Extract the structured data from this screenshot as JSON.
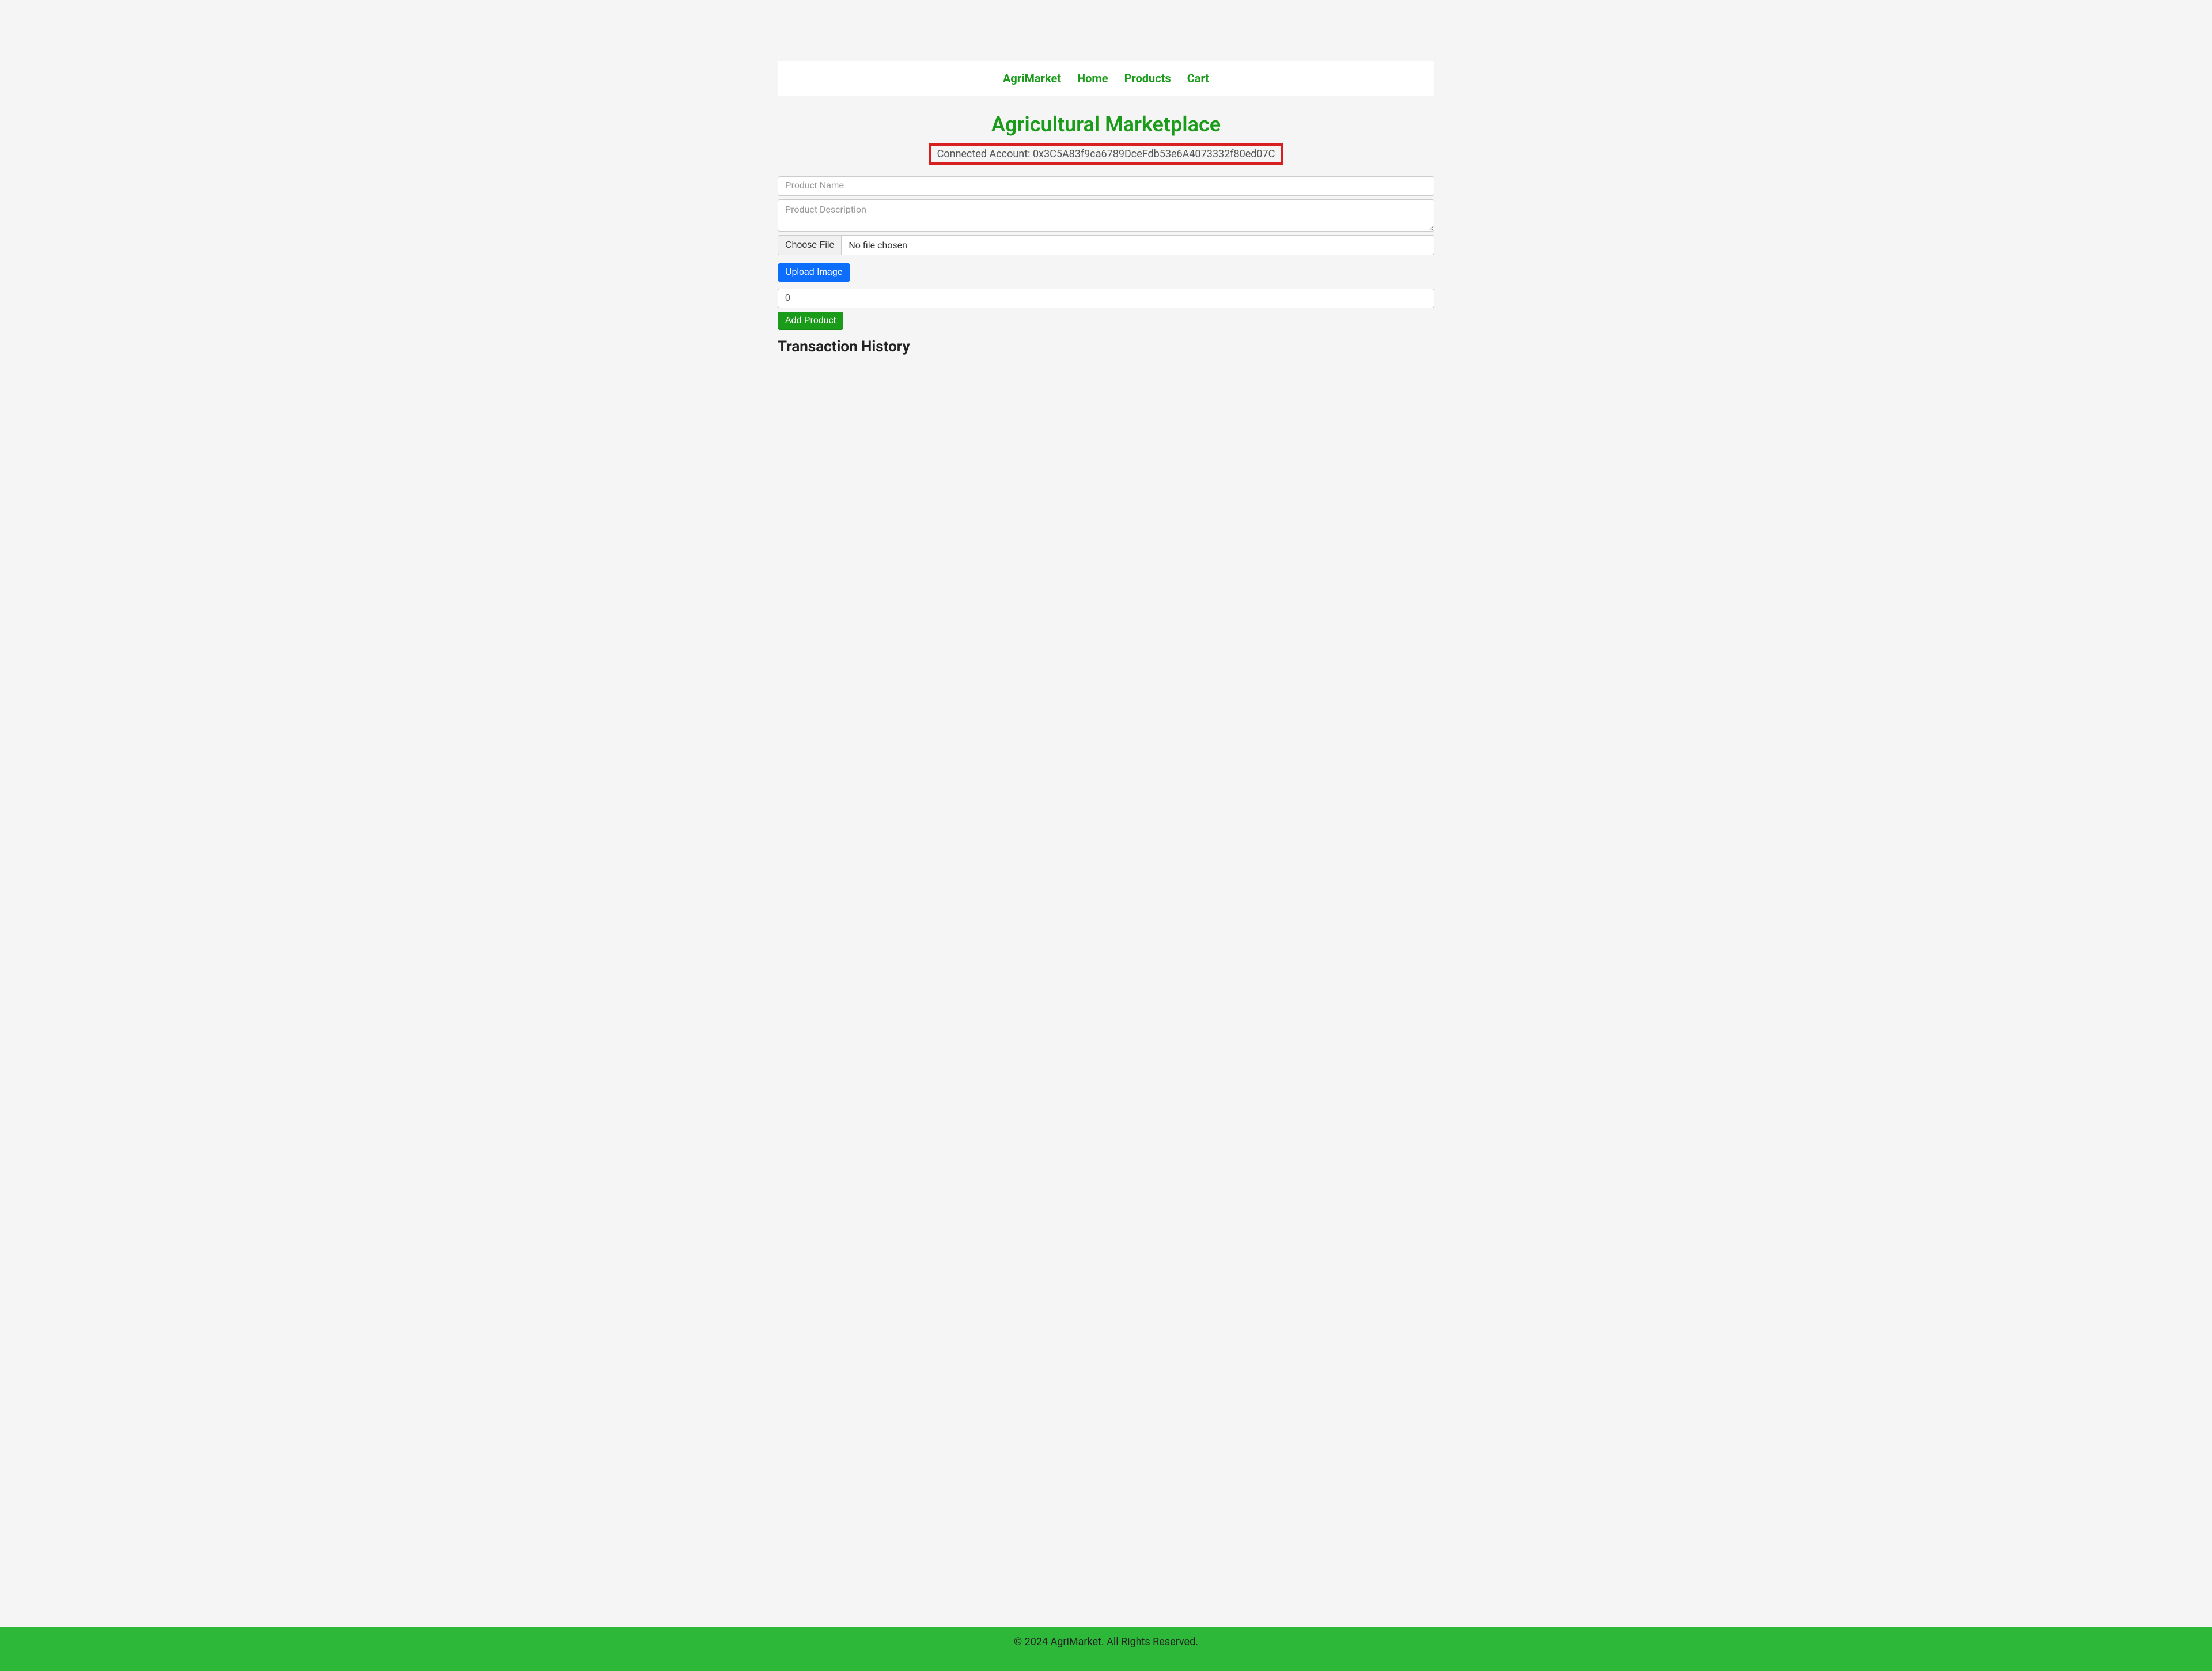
{
  "navbar": {
    "brand": "AgriMarket",
    "links": [
      {
        "label": "Home"
      },
      {
        "label": "Products"
      },
      {
        "label": "Cart"
      }
    ]
  },
  "page": {
    "title": "Agricultural Marketplace",
    "account_label": "Connected Account: 0x3C5A83f9ca6789DceFdb53e6A4073332f80ed07C"
  },
  "form": {
    "product_name_placeholder": "Product Name",
    "product_description_placeholder": "Product Description",
    "file_button_label": "Choose File",
    "file_status": "No file chosen",
    "upload_button_label": "Upload Image",
    "price_value": "0",
    "add_button_label": "Add Product"
  },
  "sections": {
    "transaction_history": "Transaction History"
  },
  "footer": {
    "text": "© 2024 AgriMarket. All Rights Reserved."
  }
}
